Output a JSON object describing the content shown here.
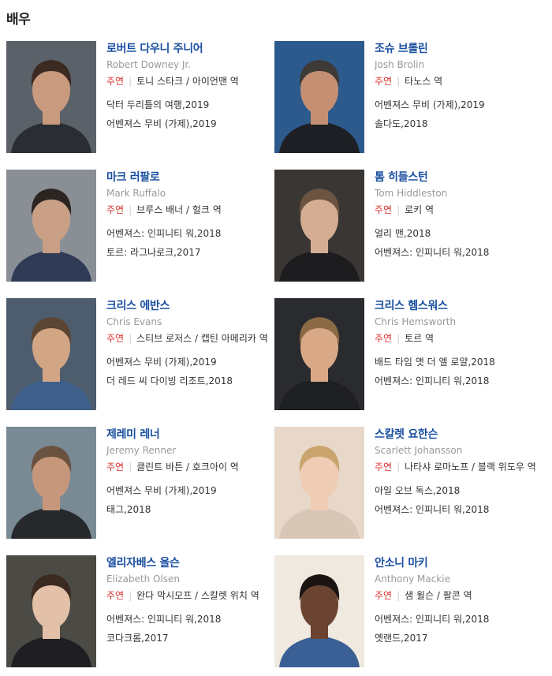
{
  "section": {
    "title": "배우"
  },
  "actors": [
    {
      "name_kr": "로버트 다우니 주니어",
      "name_en": "Robert Downey Jr.",
      "role_tag": "주연",
      "character": "토니 스타크 / 아이언맨 역",
      "works": [
        "닥터 두리틀의 여행,2019",
        "어벤져스 무비 (가제),2019"
      ],
      "bg": "#5b6168",
      "skin": "#c99a7e",
      "hair": "#3b2a22",
      "shirt": "#2a2d33"
    },
    {
      "name_kr": "조슈 브롤린",
      "name_en": "Josh Brolin",
      "role_tag": "주연",
      "character": "타노스 역",
      "works": [
        "어벤져스 무비 (가제),2019",
        "솔다도,2018"
      ],
      "bg": "#2c5a8c",
      "skin": "#c48f73",
      "hair": "#3d3a37",
      "shirt": "#1e1f24"
    },
    {
      "name_kr": "마크 러팔로",
      "name_en": "Mark Ruffalo",
      "role_tag": "주연",
      "character": "브루스 배너 / 헐크 역",
      "works": [
        "어벤져스: 인피니티 워,2018",
        "토르: 라그나로크,2017"
      ],
      "bg": "#8a8f96",
      "skin": "#c9a085",
      "hair": "#2b2420",
      "shirt": "#2f3b55"
    },
    {
      "name_kr": "톰 히들스턴",
      "name_en": "Tom Hiddleston",
      "role_tag": "주연",
      "character": "로키 역",
      "works": [
        "얼리 맨,2018",
        "어벤져스: 인피니티 워,2018"
      ],
      "bg": "#3a3633",
      "skin": "#d4ad92",
      "hair": "#6b5441",
      "shirt": "#1c1c1e"
    },
    {
      "name_kr": "크리스 에반스",
      "name_en": "Chris Evans",
      "role_tag": "주연",
      "character": "스티브 로저스 / 캡틴 아메리카 역",
      "works": [
        "어벤져스 무비 (가제),2019",
        "더 레드 씨 다이빙 리조트,2018"
      ],
      "bg": "#4d5d6e",
      "skin": "#d2a585",
      "hair": "#5c4432",
      "shirt": "#3e5f8a"
    },
    {
      "name_kr": "크리스 헴스워스",
      "name_en": "Chris Hemsworth",
      "role_tag": "주연",
      "character": "토르 역",
      "works": [
        "배드 타임 앳 더 엘 로얄,2018",
        "어벤져스: 인피니티 워,2018"
      ],
      "bg": "#2a2b2e",
      "skin": "#d9a987",
      "hair": "#8c6a45",
      "shirt": "#1f2024"
    },
    {
      "name_kr": "제레미 레너",
      "name_en": "Jeremy Renner",
      "role_tag": "주연",
      "character": "클린트 바튼 / 호크아이 역",
      "works": [
        "어벤져스 무비 (가제),2019",
        "태그,2018"
      ],
      "bg": "#7a8a94",
      "skin": "#c7977b",
      "hair": "#6a5240",
      "shirt": "#26282c"
    },
    {
      "name_kr": "스칼렛 요한슨",
      "name_en": "Scarlett Johansson",
      "role_tag": "주연",
      "character": "나타샤 로마노프 / 블랙 위도우 역",
      "works": [
        "아일 오브 독스,2018",
        "어벤져스: 인피니티 워,2018"
      ],
      "bg": "#e7d8c9",
      "skin": "#efccb4",
      "hair": "#c9a46e",
      "shirt": "#d8c7b6"
    },
    {
      "name_kr": "엘리자베스 올슨",
      "name_en": "Elizabeth Olsen",
      "role_tag": "주연",
      "character": "완다 막시모프 / 스칼렛 위치 역",
      "works": [
        "어벤져스: 인피니티 워,2018",
        "코다크롬,2017"
      ],
      "bg": "#4b4a45",
      "skin": "#e2c1a8",
      "hair": "#3a2a20",
      "shirt": "#1f1e22"
    },
    {
      "name_kr": "안소니 마키",
      "name_en": "Anthony Mackie",
      "role_tag": "주연",
      "character": "샘 윌슨 / 팔콘 역",
      "works": [
        "어벤져스: 인피니티 워,2018",
        "옛랜드,2017"
      ],
      "bg": "#f0e9e0",
      "skin": "#6b4431",
      "hair": "#1a1412",
      "shirt": "#3a5f95"
    }
  ]
}
